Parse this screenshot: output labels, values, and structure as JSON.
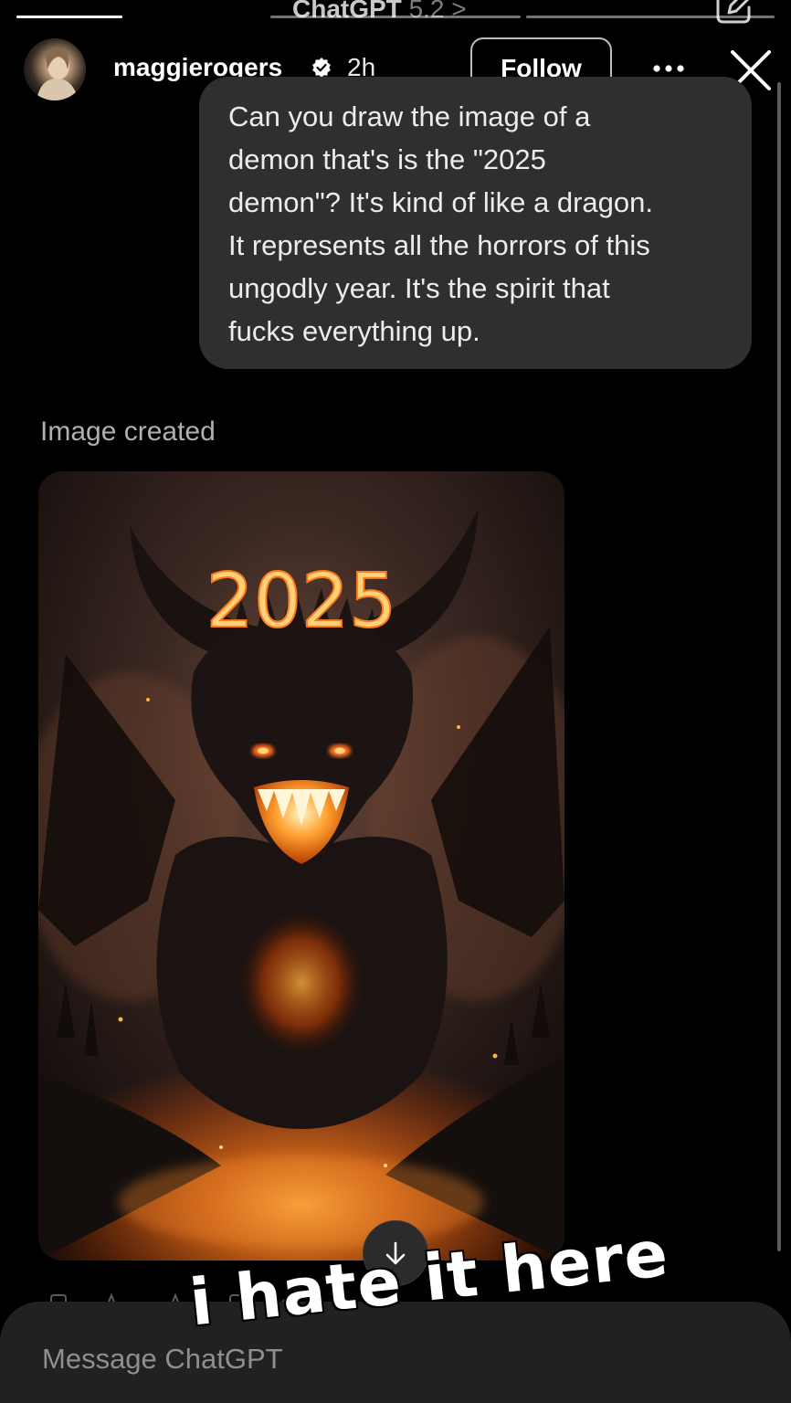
{
  "background_app": {
    "title": "ChatGPT",
    "version": "5.2",
    "version_chevron": ">",
    "composer_placeholder": "Message ChatGPT",
    "icons": [
      "menu-icon",
      "compose-icon",
      "arrow-down-icon"
    ]
  },
  "story": {
    "progress": [
      1.0,
      0.0,
      0.0
    ],
    "username": "maggierogers",
    "verified": true,
    "timestamp": "2h",
    "follow_label": "Follow",
    "icons": [
      "verified-badge-icon",
      "more-icon",
      "close-icon"
    ]
  },
  "chat": {
    "user_message": "Can you draw the image of a\ndemon that's is the \"2025\ndemon\"? It's kind of like a dragon.\nIt represents all the horrors of this\nungodly year. It's the spirit that\nfucks everything up.",
    "status": "Image created",
    "image_text": "2025"
  },
  "sticker": {
    "text": "i hate it here"
  },
  "colors": {
    "background": "#000000",
    "bubble": "#2f2f2f",
    "fire_orange": "#ff7a1a",
    "fire_glow": "#ffb347"
  }
}
